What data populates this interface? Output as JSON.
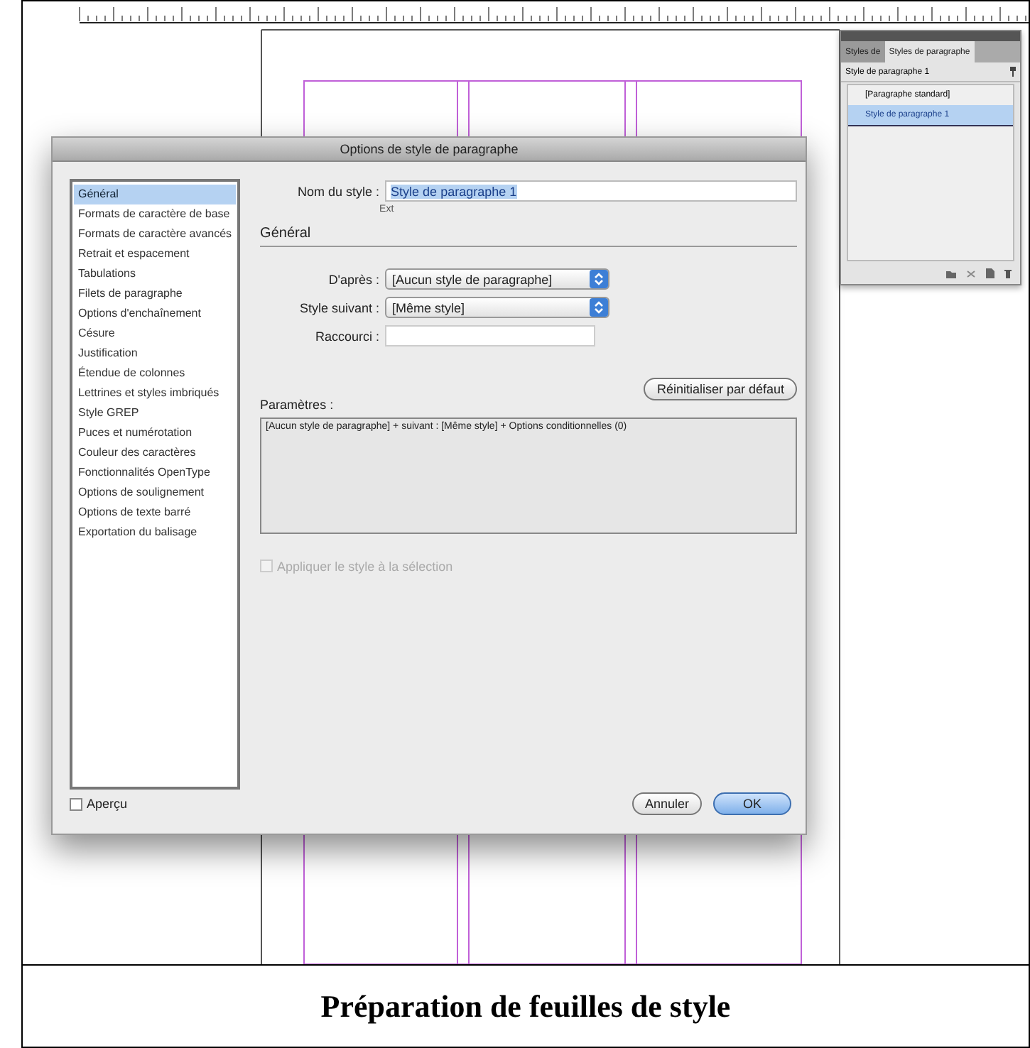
{
  "dialog": {
    "title": "Options de style de paragraphe",
    "categories": [
      {
        "label": "Général",
        "selected": true
      },
      {
        "label": "Formats de caractère de base",
        "selected": false
      },
      {
        "label": "Formats de caractère avancés",
        "selected": false
      },
      {
        "label": "Retrait et espacement",
        "selected": false
      },
      {
        "label": "Tabulations",
        "selected": false
      },
      {
        "label": "Filets de paragraphe",
        "selected": false
      },
      {
        "label": "Options d'enchaînement",
        "selected": false
      },
      {
        "label": "Césure",
        "selected": false
      },
      {
        "label": "Justification",
        "selected": false
      },
      {
        "label": "Étendue de colonnes",
        "selected": false
      },
      {
        "label": "Lettrines et styles imbriqués",
        "selected": false
      },
      {
        "label": "Style GREP",
        "selected": false
      },
      {
        "label": "Puces et numérotation",
        "selected": false
      },
      {
        "label": "Couleur des caractères",
        "selected": false
      },
      {
        "label": "Fonctionnalités OpenType",
        "selected": false
      },
      {
        "label": "Options de soulignement",
        "selected": false
      },
      {
        "label": "Options de texte barré",
        "selected": false
      },
      {
        "label": "Exportation du balisage",
        "selected": false
      }
    ],
    "style_name": {
      "label": "Nom du style :",
      "value": "Style de paragraphe 1"
    },
    "location": "Ext",
    "section": "Général",
    "fields": [
      {
        "kind": "select",
        "label": "D'après :",
        "value": "[Aucun style de paragraphe]"
      },
      {
        "kind": "select",
        "label": "Style suivant :",
        "value": "[Même style]"
      },
      {
        "kind": "input",
        "label": "Raccourci :"
      }
    ],
    "reset_button": "Réinitialiser par défaut",
    "parameters_label": "Paramètres :",
    "parameters_text": "[Aucun style de paragraphe] + suivant : [Même style] + Options conditionnelles (0)",
    "apply_checkbox": {
      "label": "Appliquer le style à la sélection",
      "checked": false,
      "disabled": true
    },
    "preview_checkbox": {
      "label": "Aperçu",
      "checked": false
    },
    "buttons": [
      {
        "label": "Annuler",
        "default": false
      },
      {
        "label": "OK",
        "default": true
      }
    ]
  },
  "panel": {
    "tabs": [
      {
        "label": "Styles de",
        "selected": false
      },
      {
        "label": "Styles de paragraphe",
        "selected": true
      }
    ],
    "current": "Style de paragraphe 1",
    "styles": [
      {
        "label": "[Paragraphe standard]",
        "selected": false
      },
      {
        "label": "Style de paragraphe 1",
        "selected": true
      }
    ]
  },
  "caption": "Préparation de feuilles de style"
}
